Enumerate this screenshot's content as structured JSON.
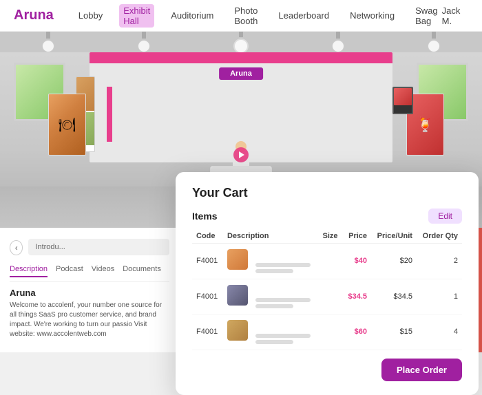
{
  "brand": {
    "logo": "Aruna",
    "color": "#a020a0"
  },
  "nav": {
    "links": [
      {
        "label": "Lobby",
        "active": false
      },
      {
        "label": "Exhibit Hall",
        "active": true
      },
      {
        "label": "Auditorium",
        "active": false
      },
      {
        "label": "Photo Booth",
        "active": false
      },
      {
        "label": "Leaderboard",
        "active": false
      },
      {
        "label": "Networking",
        "active": false
      },
      {
        "label": "Swag Bag",
        "active": false
      }
    ],
    "user": "Jack M."
  },
  "booth": {
    "label": "Aruna",
    "intro_placeholder": "Introdu...",
    "tabs": [
      {
        "label": "Description",
        "active": true
      },
      {
        "label": "Podcast",
        "active": false
      },
      {
        "label": "Videos",
        "active": false
      },
      {
        "label": "Documents",
        "active": false
      }
    ],
    "name": "Aruna",
    "description": "Welcome to accolenf, your number one source for all things SaaS pro customer service, and brand impact. We're working to turn our passio Visit website: www.accolentweb.com"
  },
  "cart": {
    "title": "Your Cart",
    "items_label": "Items",
    "edit_label": "Edit",
    "columns": {
      "code": "Code",
      "description": "Description",
      "size": "Size",
      "price": "Price",
      "price_unit": "Price/Unit",
      "order_qty": "Order Qty"
    },
    "items": [
      {
        "code": "F4001",
        "description_lines": [
          2
        ],
        "size": "",
        "price": "$40",
        "price_unit": "$20",
        "order_qty": "2",
        "thumb_type": "1"
      },
      {
        "code": "F4001",
        "description_lines": [
          2
        ],
        "size": "",
        "price": "$34.5",
        "price_unit": "$34.5",
        "order_qty": "1",
        "thumb_type": "2"
      },
      {
        "code": "F4001",
        "description_lines": [
          2
        ],
        "size": "",
        "price": "$60",
        "price_unit": "$15",
        "order_qty": "4",
        "thumb_type": "3"
      }
    ],
    "place_order_label": "Place Order"
  }
}
